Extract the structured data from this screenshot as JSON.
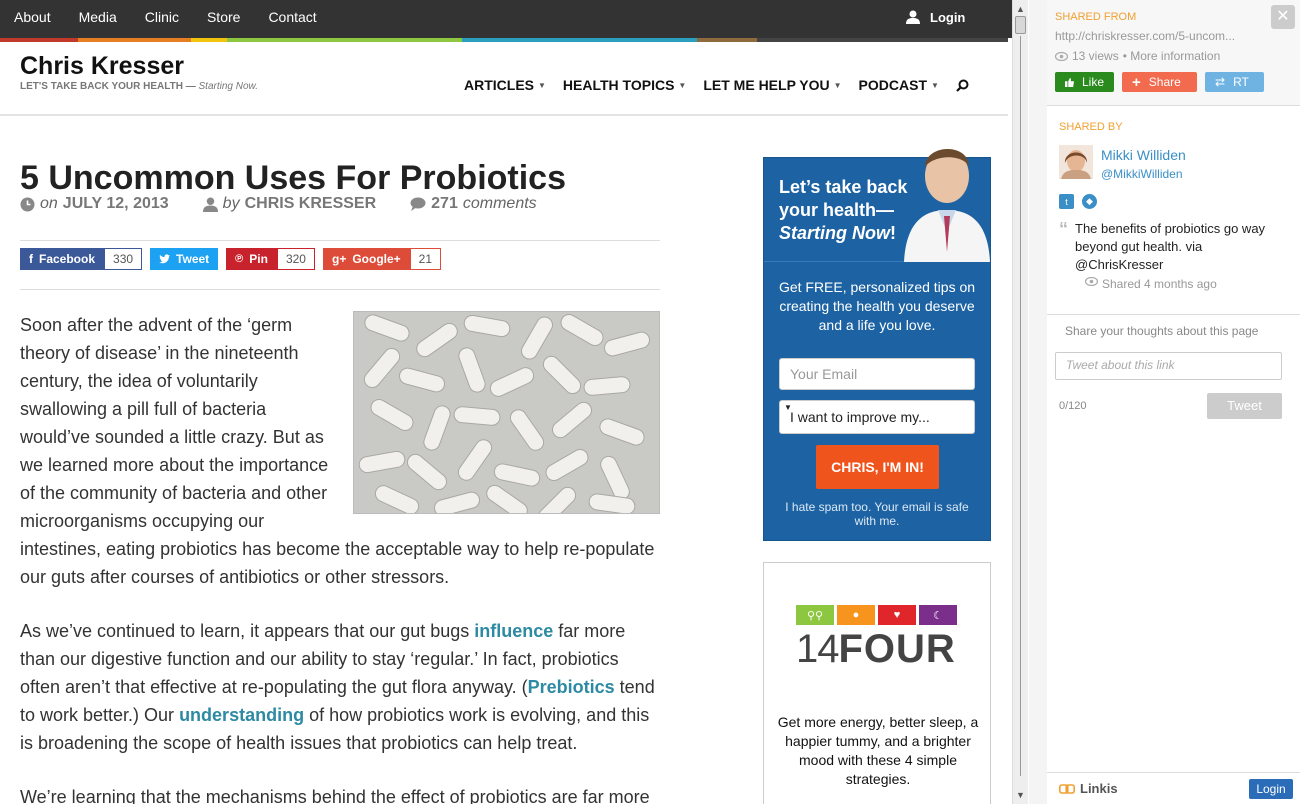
{
  "topbar": {
    "nav": [
      "About",
      "Media",
      "Clinic",
      "Store",
      "Contact"
    ],
    "login_label": "Login",
    "color_strip": [
      "#c0392b",
      "#e67e22",
      "#f1c40f",
      "#8dc63f",
      "#2a9fbf",
      "#2c3e88",
      "#8e6a3d",
      "#444444"
    ]
  },
  "site": {
    "title": "Chris Kresser",
    "tagline": "LET'S TAKE BACK YOUR HEALTH —",
    "tagline_em": "Starting Now."
  },
  "mainnav": [
    "ARTICLES",
    "HEALTH TOPICS",
    "LET ME HELP YOU",
    "PODCAST"
  ],
  "article": {
    "title": "5 Uncommon Uses For Probiotics",
    "meta": {
      "on": "on",
      "date": "JULY 12, 2013",
      "by": "by",
      "author": "CHRIS KRESSER",
      "comments_count": "271",
      "comments_label": "comments"
    },
    "social": [
      {
        "label": "Facebook",
        "count": "330",
        "color": "#3b5998"
      },
      {
        "label": "Tweet",
        "count": "",
        "color": "#1da1f2"
      },
      {
        "label": "Pin",
        "count": "320",
        "color": "#c8232c"
      },
      {
        "label": "Google+",
        "count": "21",
        "color": "#dd4b39"
      }
    ],
    "p1": "Soon after the advent of the ‘germ theory of disease’ in the nineteenth century, the idea of voluntarily swallowing a pill full of bacteria would’ve sounded a little crazy. But as we learned more about the importance of the community of bacteria and other microorganisms occupying our intestines, eating probiotics has become the acceptable way to help re-populate our guts after courses of antibiotics or other stressors.",
    "p2_a": "As we’ve continued to learn, it appears that our gut bugs ",
    "p2_link1": "influence",
    "p2_b": " far more than our digestive function and our ability to stay ‘regular.’ In fact, probiotics often aren’t that effective at re-populating the gut flora anyway. (",
    "p2_link2": "Prebiotics",
    "p2_c": " tend to work better.) Our ",
    "p2_link3": "understanding",
    "p2_d": " of how probiotics work is evolving, and this is broadening the scope of health issues that probiotics can help treat.",
    "p3": "We’re learning that the mechanisms behind the effect of probiotics are far more"
  },
  "optin": {
    "heading_1": "Let’s take back your health—",
    "heading_em": "Starting Now",
    "heading_end": "!",
    "copy": "Get FREE, personalized tips on creating the health you deserve and a life you love.",
    "email_placeholder": "Your Email",
    "select_value": "I want to improve my...",
    "cta": "CHRIS, I'M IN!",
    "spam": "I hate spam too. Your email is safe with me."
  },
  "ad": {
    "logo_light": "14",
    "logo_bold": "FOUR",
    "text": "Get more energy, better sleep, a happier tummy, and a brighter mood with these 4 simple strategies.",
    "icon_colors": [
      "#8dc63f",
      "#f7941d",
      "#e0262a",
      "#7a2f8b"
    ]
  },
  "panel": {
    "shared_from": "SHARED FROM",
    "url": "http://chriskresser.com/5-uncom...",
    "views": "13 views",
    "more": "• More information",
    "like": "Like",
    "share": "Share",
    "rt": "RT",
    "shared_by": "SHARED BY",
    "name": "Mikki Williden",
    "handle": "@MikkiWilliden",
    "quote": "The benefits of probiotics go way beyond gut health. via @ChrisKresser",
    "shared_time": "Shared 4 months ago",
    "thoughts": "Share your thoughts about this page",
    "tweet_placeholder": "Tweet about this link",
    "counter": "0/120",
    "tweet_btn": "Tweet",
    "brand": "Linkis",
    "login": "Login"
  }
}
